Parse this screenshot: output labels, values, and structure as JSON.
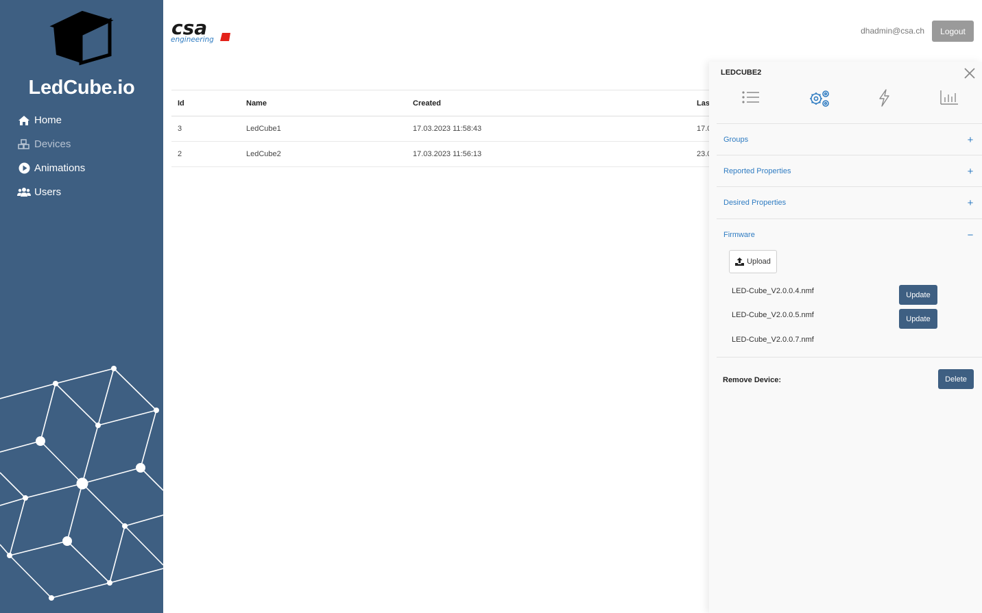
{
  "sidebar": {
    "brand_title": "LedCube.io",
    "items": [
      {
        "label": "Home",
        "icon": "home-icon",
        "enabled": true
      },
      {
        "label": "Devices",
        "icon": "cubes-icon",
        "enabled": false
      },
      {
        "label": "Animations",
        "icon": "play-circle-icon",
        "enabled": true
      },
      {
        "label": "Users",
        "icon": "users-icon",
        "enabled": true
      }
    ]
  },
  "header": {
    "logo_text": "csa",
    "logo_subtext": "engineering",
    "user_email": "dhadmin@csa.ch",
    "logout_label": "Logout"
  },
  "table": {
    "columns": [
      "Id",
      "Name",
      "Created",
      "Last"
    ],
    "rows": [
      {
        "id": "3",
        "name": "LedCube1",
        "created": "17.03.2023 11:58:43",
        "last": "17.0"
      },
      {
        "id": "2",
        "name": "LedCube2",
        "created": "17.03.2023 11:56:13",
        "last": "23.0"
      }
    ]
  },
  "panel": {
    "title": "LEDCUBE2",
    "tabs": [
      "list-icon",
      "gears-icon",
      "bolt-icon",
      "chart-icon"
    ],
    "active_tab": 1,
    "sections": {
      "groups": "Groups",
      "reported": "Reported Properties",
      "desired": "Desired Properties",
      "firmware": "Firmware"
    },
    "upload_label": "Upload",
    "firmware_files": [
      {
        "name": "LED-Cube_V2.0.0.4.nmf",
        "update_label": "Update"
      },
      {
        "name": "LED-Cube_V2.0.0.5.nmf",
        "update_label": "Update"
      },
      {
        "name": "LED-Cube_V2.0.0.7.nmf",
        "update_label": ""
      }
    ],
    "remove_label": "Remove Device:",
    "delete_label": "Delete"
  },
  "colors": {
    "sidebar_bg": "#3e5f82",
    "accent_link": "#2f7cc2",
    "button_primary": "#3e5f82",
    "logout_bg": "#9a9a9a",
    "logo_red": "#e32119"
  }
}
